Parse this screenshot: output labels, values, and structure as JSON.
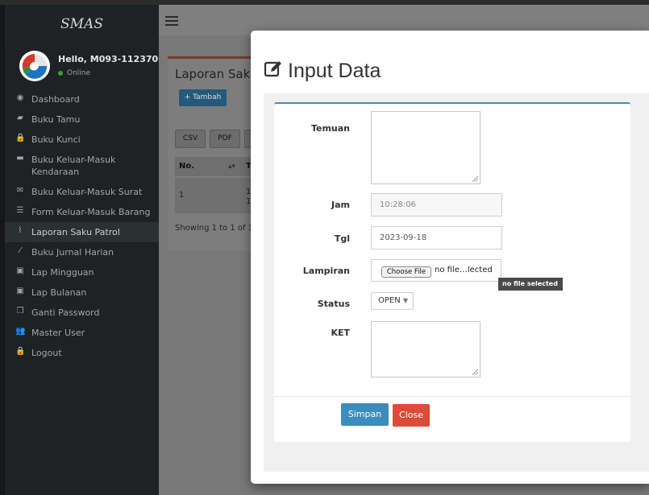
{
  "sidebar": {
    "brand": "SMAS",
    "user_name": "Hello, M093-112370",
    "user_status": "Online",
    "items": [
      {
        "label": "Dashboard",
        "icon": "dashboard-icon",
        "glyph": "◉"
      },
      {
        "label": "Buku Tamu",
        "icon": "book-icon",
        "glyph": "▰"
      },
      {
        "label": "Buku Kunci",
        "icon": "lock-icon",
        "glyph": "🔒"
      },
      {
        "label": "Buku Keluar-Masuk Kendaraan",
        "icon": "truck-icon",
        "glyph": "▬"
      },
      {
        "label": "Buku Keluar-Masuk Surat",
        "icon": "envelope-icon",
        "glyph": "✉"
      },
      {
        "label": "Form Keluar-Masuk Barang",
        "icon": "list-icon",
        "glyph": "☰"
      },
      {
        "label": "Laporan Saku Patrol",
        "icon": "paperclip-icon",
        "glyph": "⌇"
      },
      {
        "label": "Buku Jurnal Harian",
        "icon": "wand-icon",
        "glyph": "⁄"
      },
      {
        "label": "Lap Mingguan",
        "icon": "money-icon",
        "glyph": "▣"
      },
      {
        "label": "Lap Bulanan",
        "icon": "money-icon",
        "glyph": "▣"
      },
      {
        "label": "Ganti Password",
        "icon": "copy-icon",
        "glyph": "❐"
      },
      {
        "label": "Master User",
        "icon": "users-icon",
        "glyph": "👥"
      },
      {
        "label": "Logout",
        "icon": "lock-icon",
        "glyph": "🔒"
      }
    ]
  },
  "background": {
    "title": "Laporan Saku",
    "add_button": "+ Tambah",
    "export_buttons": [
      "CSV",
      "PDF"
    ],
    "table_header": "No.",
    "table_header_extra": "T",
    "row_no": "1",
    "row_extra_1": "1",
    "row_extra_2": "1",
    "showing": "Showing 1 to 1 of 1"
  },
  "modal": {
    "title": "Input Data",
    "fields": {
      "temuan_label": "Temuan",
      "temuan_value": "",
      "jam_label": "Jam",
      "jam_value": "10:28:06",
      "tgl_label": "Tgl",
      "tgl_value": "2023-09-18",
      "lampiran_label": "Lampiran",
      "file_button": "Choose File",
      "file_text": "no file…lected",
      "file_tooltip": "no file selected",
      "status_label": "Status",
      "status_value": "OPEN",
      "ket_label": "KET",
      "ket_value": ""
    },
    "buttons": {
      "save": "Simpan",
      "close": "Close"
    }
  },
  "colors": {
    "primary": "#3c8dbc",
    "danger": "#dd4b39",
    "sidebar_bg": "#1f2224",
    "status_online": "#3c9a3c"
  }
}
